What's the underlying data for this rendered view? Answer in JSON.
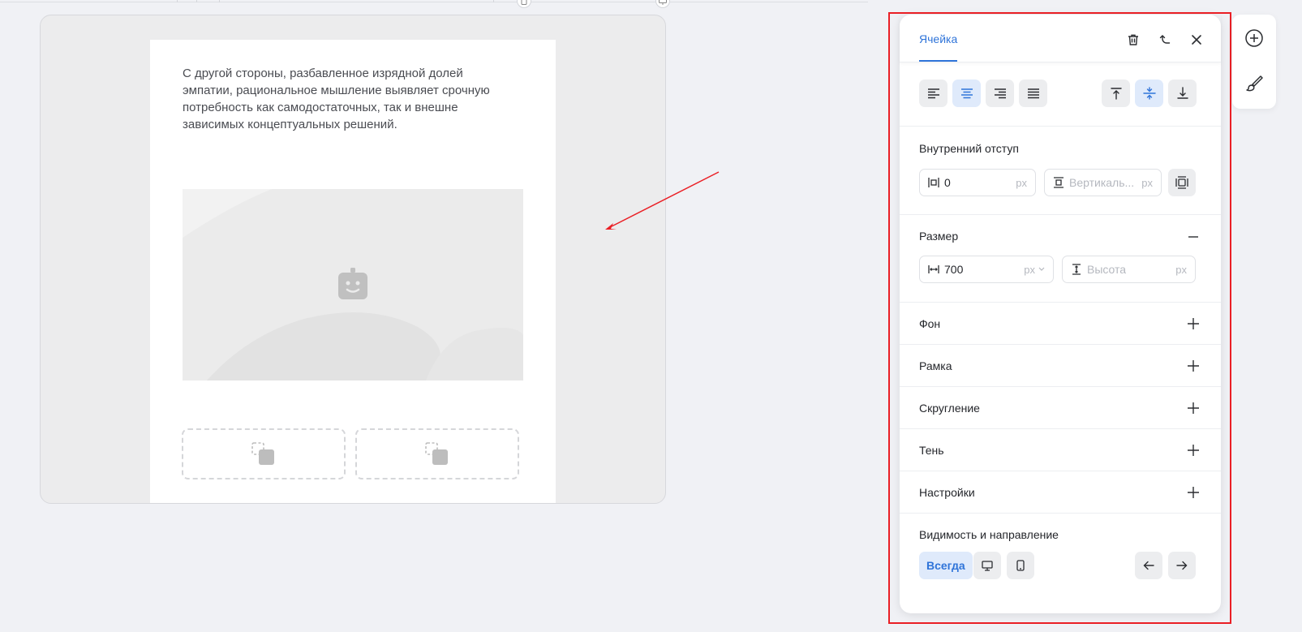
{
  "email": {
    "text": "С другой стороны, разбавленное изрядной долей эмпатии, рациональное мышление выявляет срочную потребность как самодостаточных, так и внешне зависимых концептуальных решений."
  },
  "panel": {
    "tab_label": "Ячейка",
    "padding": {
      "label": "Внутренний отступ",
      "horizontal_value": "0",
      "horizontal_unit": "px",
      "vertical_placeholder": "Вертикаль...",
      "vertical_unit": "px"
    },
    "size": {
      "label": "Размер",
      "width_value": "700",
      "width_unit": "px",
      "height_placeholder": "Высота",
      "height_unit": "px"
    },
    "sections": [
      "Фон",
      "Рамка",
      "Скругление",
      "Тень",
      "Настройки"
    ],
    "visibility": {
      "label": "Видимость и направление",
      "always_label": "Всегда"
    }
  },
  "colors": {
    "accent": "#2f74d9",
    "highlight": "#ea1f25"
  },
  "icons": {
    "align": [
      "align-left-icon",
      "align-center-icon",
      "align-right-icon",
      "align-justify-icon"
    ],
    "valign": [
      "valign-top-icon",
      "valign-middle-icon",
      "valign-bottom-icon"
    ]
  }
}
